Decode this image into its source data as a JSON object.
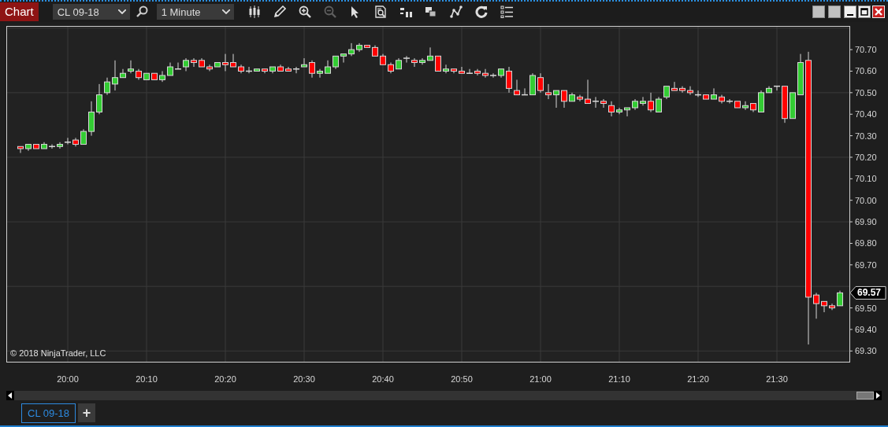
{
  "toolbar": {
    "title": "Chart",
    "instrument": {
      "value": "CL 09-18"
    },
    "interval": {
      "value": "1 Minute"
    },
    "buttons": [
      {
        "kind": "search",
        "disabled": false
      },
      {
        "kind": "bars",
        "disabled": false
      },
      {
        "kind": "pencil",
        "disabled": false
      },
      {
        "kind": "zoom-in",
        "disabled": false
      },
      {
        "kind": "zoom-out",
        "disabled": true
      },
      {
        "kind": "pointer",
        "disabled": false
      },
      {
        "kind": "properties",
        "disabled": false
      },
      {
        "kind": "scale",
        "disabled": false
      },
      {
        "kind": "overlap",
        "disabled": false
      },
      {
        "kind": "line",
        "disabled": false
      },
      {
        "kind": "reload",
        "disabled": false
      },
      {
        "kind": "list",
        "disabled": false
      }
    ]
  },
  "window_buttons": [
    {
      "kind": "tile"
    },
    {
      "kind": "tile"
    },
    {
      "kind": "minimize"
    },
    {
      "kind": "maximize"
    },
    {
      "kind": "close"
    }
  ],
  "chart": {
    "copyright": "© 2018 NinjaTrader, LLC",
    "chart_data": {
      "type": "candlestick",
      "grid": true,
      "ylim": [
        69.25,
        70.81
      ],
      "x": [
        1194,
        1195,
        1196,
        1197,
        1198,
        1199,
        1200,
        1201,
        1202,
        1203,
        1204,
        1205,
        1206,
        1207,
        1208,
        1209,
        1210,
        1211,
        1212,
        1213,
        1214,
        1215,
        1216,
        1217,
        1218,
        1219,
        1220,
        1221,
        1222,
        1223,
        1224,
        1225,
        1226,
        1227,
        1228,
        1229,
        1230,
        1231,
        1232,
        1233,
        1234,
        1235,
        1236,
        1237,
        1238,
        1239,
        1240,
        1241,
        1242,
        1243,
        1244,
        1245,
        1246,
        1247,
        1248,
        1249,
        1250,
        1251,
        1252,
        1253,
        1254,
        1255,
        1256,
        1257,
        1258,
        1259,
        1260,
        1261,
        1262,
        1263,
        1264,
        1265,
        1266,
        1267,
        1268,
        1269,
        1270,
        1271,
        1272,
        1273,
        1274,
        1275,
        1276,
        1277,
        1278,
        1279,
        1280,
        1281,
        1282,
        1283,
        1284,
        1285,
        1286,
        1287,
        1288,
        1289,
        1290,
        1291,
        1292,
        1293,
        1294,
        1295,
        1296,
        1297,
        1298
      ],
      "xlim": [
        1192.2,
        1299.2
      ],
      "xticks": [
        {
          "value": 1200,
          "label": "20:00"
        },
        {
          "value": 1210,
          "label": "20:10"
        },
        {
          "value": 1220,
          "label": "20:20"
        },
        {
          "value": 1230,
          "label": "20:30"
        },
        {
          "value": 1240,
          "label": "20:40"
        },
        {
          "value": 1250,
          "label": "20:50"
        },
        {
          "value": 1260,
          "label": "21:00"
        },
        {
          "value": 1270,
          "label": "21:10"
        },
        {
          "value": 1280,
          "label": "21:20"
        },
        {
          "value": 1290,
          "label": "21:30"
        }
      ],
      "yticks": [
        {
          "value": 70.7,
          "label": "70.70"
        },
        {
          "value": 70.6,
          "label": "70.60"
        },
        {
          "value": 70.5,
          "label": "70.50"
        },
        {
          "value": 70.4,
          "label": "70.40"
        },
        {
          "value": 70.3,
          "label": "70.30"
        },
        {
          "value": 70.2,
          "label": "70.20"
        },
        {
          "value": 70.1,
          "label": "70.10"
        },
        {
          "value": 70.0,
          "label": "70.00"
        },
        {
          "value": 69.9,
          "label": "69.90"
        },
        {
          "value": 69.8,
          "label": "69.80"
        },
        {
          "value": 69.7,
          "label": "69.70"
        },
        {
          "value": 69.5,
          "label": "69.50"
        },
        {
          "value": 69.4,
          "label": "69.40"
        },
        {
          "value": 69.3,
          "label": "69.30"
        }
      ],
      "ohlc": [
        [
          70.25,
          70.25,
          70.22,
          70.24
        ],
        [
          70.24,
          70.26,
          70.23,
          70.26
        ],
        [
          70.26,
          70.26,
          70.24,
          70.24
        ],
        [
          70.24,
          70.27,
          70.24,
          70.26
        ],
        [
          70.25,
          70.26,
          70.24,
          70.25
        ],
        [
          70.25,
          70.27,
          70.24,
          70.26
        ],
        [
          70.27,
          70.29,
          70.26,
          70.27
        ],
        [
          70.28,
          70.29,
          70.25,
          70.26
        ],
        [
          70.26,
          70.33,
          70.26,
          70.32
        ],
        [
          70.32,
          70.46,
          70.3,
          70.41
        ],
        [
          70.41,
          70.54,
          70.4,
          70.49
        ],
        [
          70.5,
          70.57,
          70.49,
          70.55
        ],
        [
          70.54,
          70.65,
          70.51,
          70.57
        ],
        [
          70.57,
          70.61,
          70.57,
          70.59
        ],
        [
          70.6,
          70.65,
          70.59,
          70.61
        ],
        [
          70.6,
          70.61,
          70.56,
          70.57
        ],
        [
          70.56,
          70.59,
          70.56,
          70.59
        ],
        [
          70.59,
          70.59,
          70.56,
          70.56
        ],
        [
          70.56,
          70.6,
          70.55,
          70.58
        ],
        [
          70.58,
          70.64,
          70.58,
          70.62
        ],
        [
          70.61,
          70.64,
          70.61,
          70.61
        ],
        [
          70.62,
          70.66,
          70.6,
          70.65
        ],
        [
          70.65,
          70.66,
          70.62,
          70.64
        ],
        [
          70.65,
          70.66,
          70.62,
          70.62
        ],
        [
          70.62,
          70.63,
          70.6,
          70.61
        ],
        [
          70.62,
          70.64,
          70.62,
          70.64
        ],
        [
          70.64,
          70.68,
          70.6,
          70.63
        ],
        [
          70.64,
          70.68,
          70.62,
          70.62
        ],
        [
          70.62,
          70.63,
          70.59,
          70.6
        ],
        [
          70.6,
          70.62,
          70.59,
          70.6
        ],
        [
          70.6,
          70.61,
          70.6,
          70.61
        ],
        [
          70.61,
          70.61,
          70.59,
          70.6
        ],
        [
          70.6,
          70.62,
          70.59,
          70.62
        ],
        [
          70.62,
          70.63,
          70.6,
          70.6
        ],
        [
          70.61,
          70.62,
          70.6,
          70.6
        ],
        [
          70.61,
          70.62,
          70.59,
          70.61
        ],
        [
          70.62,
          70.66,
          70.62,
          70.63
        ],
        [
          70.64,
          70.65,
          70.57,
          70.59
        ],
        [
          70.59,
          70.61,
          70.57,
          70.6
        ],
        [
          70.59,
          70.65,
          70.59,
          70.62
        ],
        [
          70.62,
          70.67,
          70.61,
          70.67
        ],
        [
          70.67,
          70.68,
          70.64,
          70.68
        ],
        [
          70.68,
          70.73,
          70.67,
          70.7
        ],
        [
          70.7,
          70.73,
          70.69,
          70.72
        ],
        [
          70.72,
          70.72,
          70.71,
          70.71
        ],
        [
          70.71,
          70.72,
          70.67,
          70.67
        ],
        [
          70.67,
          70.68,
          70.63,
          70.63
        ],
        [
          70.63,
          70.64,
          70.59,
          70.6
        ],
        [
          70.61,
          70.66,
          70.61,
          70.65
        ],
        [
          70.66,
          70.67,
          70.64,
          70.66
        ],
        [
          70.65,
          70.66,
          70.62,
          70.64
        ],
        [
          70.64,
          70.66,
          70.63,
          70.65
        ],
        [
          70.65,
          70.71,
          70.65,
          70.67
        ],
        [
          70.67,
          70.67,
          70.6,
          70.6
        ],
        [
          70.6,
          70.63,
          70.59,
          70.61
        ],
        [
          70.61,
          70.61,
          70.59,
          70.6
        ],
        [
          70.6,
          70.62,
          70.59,
          70.59
        ],
        [
          70.59,
          70.61,
          70.59,
          70.59
        ],
        [
          70.6,
          70.61,
          70.58,
          70.59
        ],
        [
          70.59,
          70.61,
          70.57,
          70.58
        ],
        [
          70.58,
          70.59,
          70.57,
          70.58
        ],
        [
          70.58,
          70.61,
          70.57,
          70.61
        ],
        [
          70.6,
          70.62,
          70.5,
          70.52
        ],
        [
          70.51,
          70.56,
          70.49,
          70.49
        ],
        [
          70.49,
          70.52,
          70.49,
          70.49
        ],
        [
          70.49,
          70.59,
          70.49,
          70.58
        ],
        [
          70.57,
          70.59,
          70.5,
          70.51
        ],
        [
          70.5,
          70.54,
          70.47,
          70.49
        ],
        [
          70.49,
          70.51,
          70.43,
          70.51
        ],
        [
          70.51,
          70.51,
          70.43,
          70.46
        ],
        [
          70.46,
          70.5,
          70.46,
          70.49
        ],
        [
          70.48,
          70.49,
          70.46,
          70.47
        ],
        [
          70.47,
          70.56,
          70.45,
          70.45
        ],
        [
          70.46,
          70.48,
          70.43,
          70.46
        ],
        [
          70.46,
          70.47,
          70.43,
          70.45
        ],
        [
          70.44,
          70.46,
          70.39,
          70.41
        ],
        [
          70.41,
          70.43,
          70.4,
          70.42
        ],
        [
          70.42,
          70.43,
          70.39,
          70.43
        ],
        [
          70.43,
          70.47,
          70.42,
          70.46
        ],
        [
          70.45,
          70.48,
          70.44,
          70.46
        ],
        [
          70.46,
          70.5,
          70.41,
          70.42
        ],
        [
          70.41,
          70.48,
          70.41,
          70.47
        ],
        [
          70.48,
          70.53,
          70.47,
          70.53
        ],
        [
          70.52,
          70.55,
          70.51,
          70.51
        ],
        [
          70.52,
          70.53,
          70.5,
          70.51
        ],
        [
          70.51,
          70.53,
          70.49,
          70.5
        ],
        [
          70.49,
          70.51,
          70.48,
          70.49
        ],
        [
          70.49,
          70.49,
          70.47,
          70.47
        ],
        [
          70.47,
          70.52,
          70.47,
          70.49
        ],
        [
          70.48,
          70.49,
          70.45,
          70.46
        ],
        [
          70.46,
          70.47,
          70.45,
          70.46
        ],
        [
          70.46,
          70.46,
          70.43,
          70.43
        ],
        [
          70.43,
          70.46,
          70.42,
          70.44
        ],
        [
          70.45,
          70.45,
          70.41,
          70.42
        ],
        [
          70.41,
          70.51,
          70.41,
          70.5
        ],
        [
          70.5,
          70.53,
          70.5,
          70.52
        ],
        [
          70.53,
          70.53,
          70.51,
          70.53
        ],
        [
          70.53,
          70.53,
          70.36,
          70.38
        ],
        [
          70.38,
          70.5,
          70.38,
          70.5
        ],
        [
          70.49,
          70.68,
          70.49,
          70.64
        ],
        [
          70.65,
          70.69,
          69.33,
          69.55
        ],
        [
          69.56,
          69.57,
          69.45,
          69.52
        ],
        [
          69.53,
          69.53,
          69.48,
          69.51
        ],
        [
          69.51,
          69.52,
          69.49,
          69.5
        ],
        [
          69.51,
          69.58,
          69.51,
          69.57
        ]
      ],
      "annotations": [
        "69.57"
      ]
    }
  },
  "tabs": [
    {
      "label": "CL 09-18",
      "selected": true
    }
  ],
  "add_tab": {
    "label": "+"
  }
}
